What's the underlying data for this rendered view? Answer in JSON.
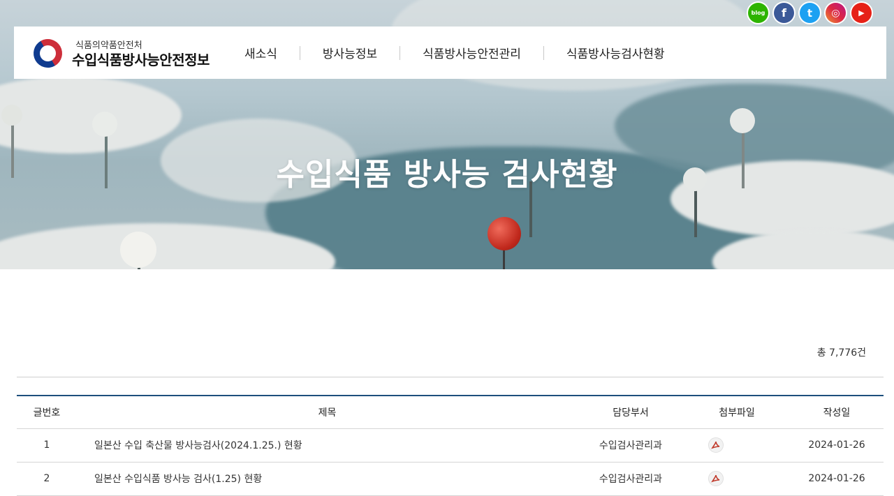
{
  "header": {
    "agency": "식품의약품안전처",
    "site_name": "수입식품방사능안전정보",
    "nav": [
      "새소식",
      "방사능정보",
      "식품방사능안전관리",
      "식품방사능검사현황"
    ]
  },
  "social": [
    {
      "icon": "blog-icon",
      "label": "blog",
      "color": "#2db400"
    },
    {
      "icon": "facebook-icon",
      "label": "f",
      "color": "#3b5998"
    },
    {
      "icon": "twitter-icon",
      "label": "t",
      "color": "#1da1f2"
    },
    {
      "icon": "instagram-icon",
      "label": "◎",
      "color": "#c13584"
    },
    {
      "icon": "youtube-icon",
      "label": "▶",
      "color": "#e62117"
    }
  ],
  "hero": {
    "title": "수입식품 방사능 검사현황"
  },
  "board": {
    "total_text": "총 7,776건",
    "columns": [
      "글번호",
      "제목",
      "담당부서",
      "첨부파일",
      "작성일"
    ],
    "rows": [
      {
        "num": "1",
        "title": "일본산 수입 축산물 방사능검사(2024.1.25.) 현황",
        "dept": "수입검사관리과",
        "file": "pdf-icon",
        "date": "2024-01-26"
      },
      {
        "num": "2",
        "title": "일본산 수입식품 방사능 검사(1.25) 현황",
        "dept": "수입검사관리과",
        "file": "pdf-icon",
        "date": "2024-01-26"
      }
    ]
  },
  "colors": {
    "accent": "#1d4f7c",
    "pdf": "#c0392b"
  }
}
